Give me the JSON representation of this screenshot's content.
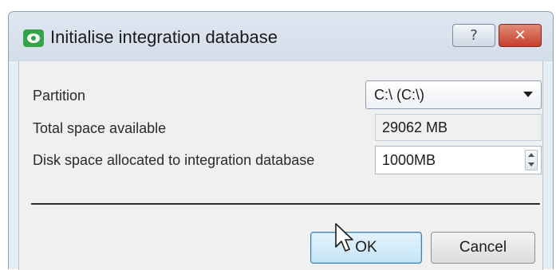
{
  "window": {
    "title": "Initialise integration database",
    "app_icon": "eye-icon",
    "help_label": "?",
    "close_label": "✕",
    "colors": {
      "app_icon": "#33a44a",
      "close_button": "#c3412d",
      "ok_button_highlight": "#c5e4f7"
    }
  },
  "form": {
    "partition": {
      "label": "Partition",
      "selected": "C:\\ (C:\\)"
    },
    "total_space": {
      "label": "Total space available",
      "value": "29062 MB"
    },
    "disk_space": {
      "label": "Disk space allocated to integration database",
      "value": "1000MB"
    }
  },
  "buttons": {
    "ok_label": "OK",
    "cancel_label": "Cancel"
  },
  "cursor": {
    "icon": "mouse-pointer-icon"
  }
}
